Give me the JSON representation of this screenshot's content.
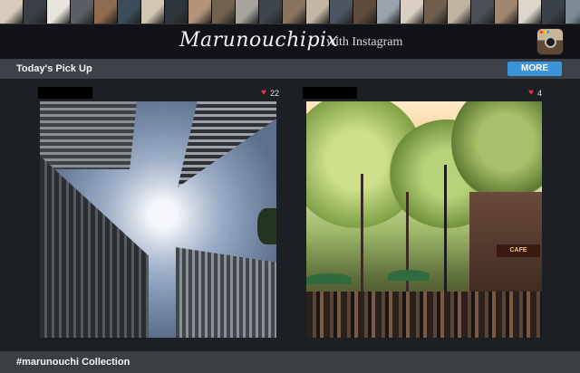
{
  "header": {
    "brand": "Marunouchipix",
    "brand_suffix": "with Instagram",
    "instagram_icon": "instagram-camera-icon"
  },
  "thumbnail_strip": {
    "colors": [
      "#d8cbbd",
      "#3a3f46",
      "#e9e6df",
      "#5a5e64",
      "#8e6a4f",
      "#3c4c5a",
      "#d2c6b4",
      "#2e343c",
      "#b39378",
      "#70624f",
      "#a8a49e",
      "#3f454c",
      "#8a7460",
      "#c3b8a6",
      "#4c5561",
      "#5e4b3c",
      "#9aa2ad",
      "#d9d0c3",
      "#6f5e4c",
      "#bfb3a1",
      "#4a4f55",
      "#a0876e",
      "#dcd6cc",
      "#3b4148",
      "#7c8a96"
    ]
  },
  "pickup": {
    "title": "Today's Pick Up",
    "more_label": "MORE"
  },
  "posts": [
    {
      "likes": "22",
      "heart_icon": "heart-icon",
      "photo": "skyscrapers-looking-up-photo"
    },
    {
      "likes": "4",
      "heart_icon": "heart-icon",
      "photo": "tree-lined-street-cafe-photo",
      "sign_text": "CAFE"
    }
  ],
  "collection": {
    "title": "#marunouchi Collection"
  }
}
